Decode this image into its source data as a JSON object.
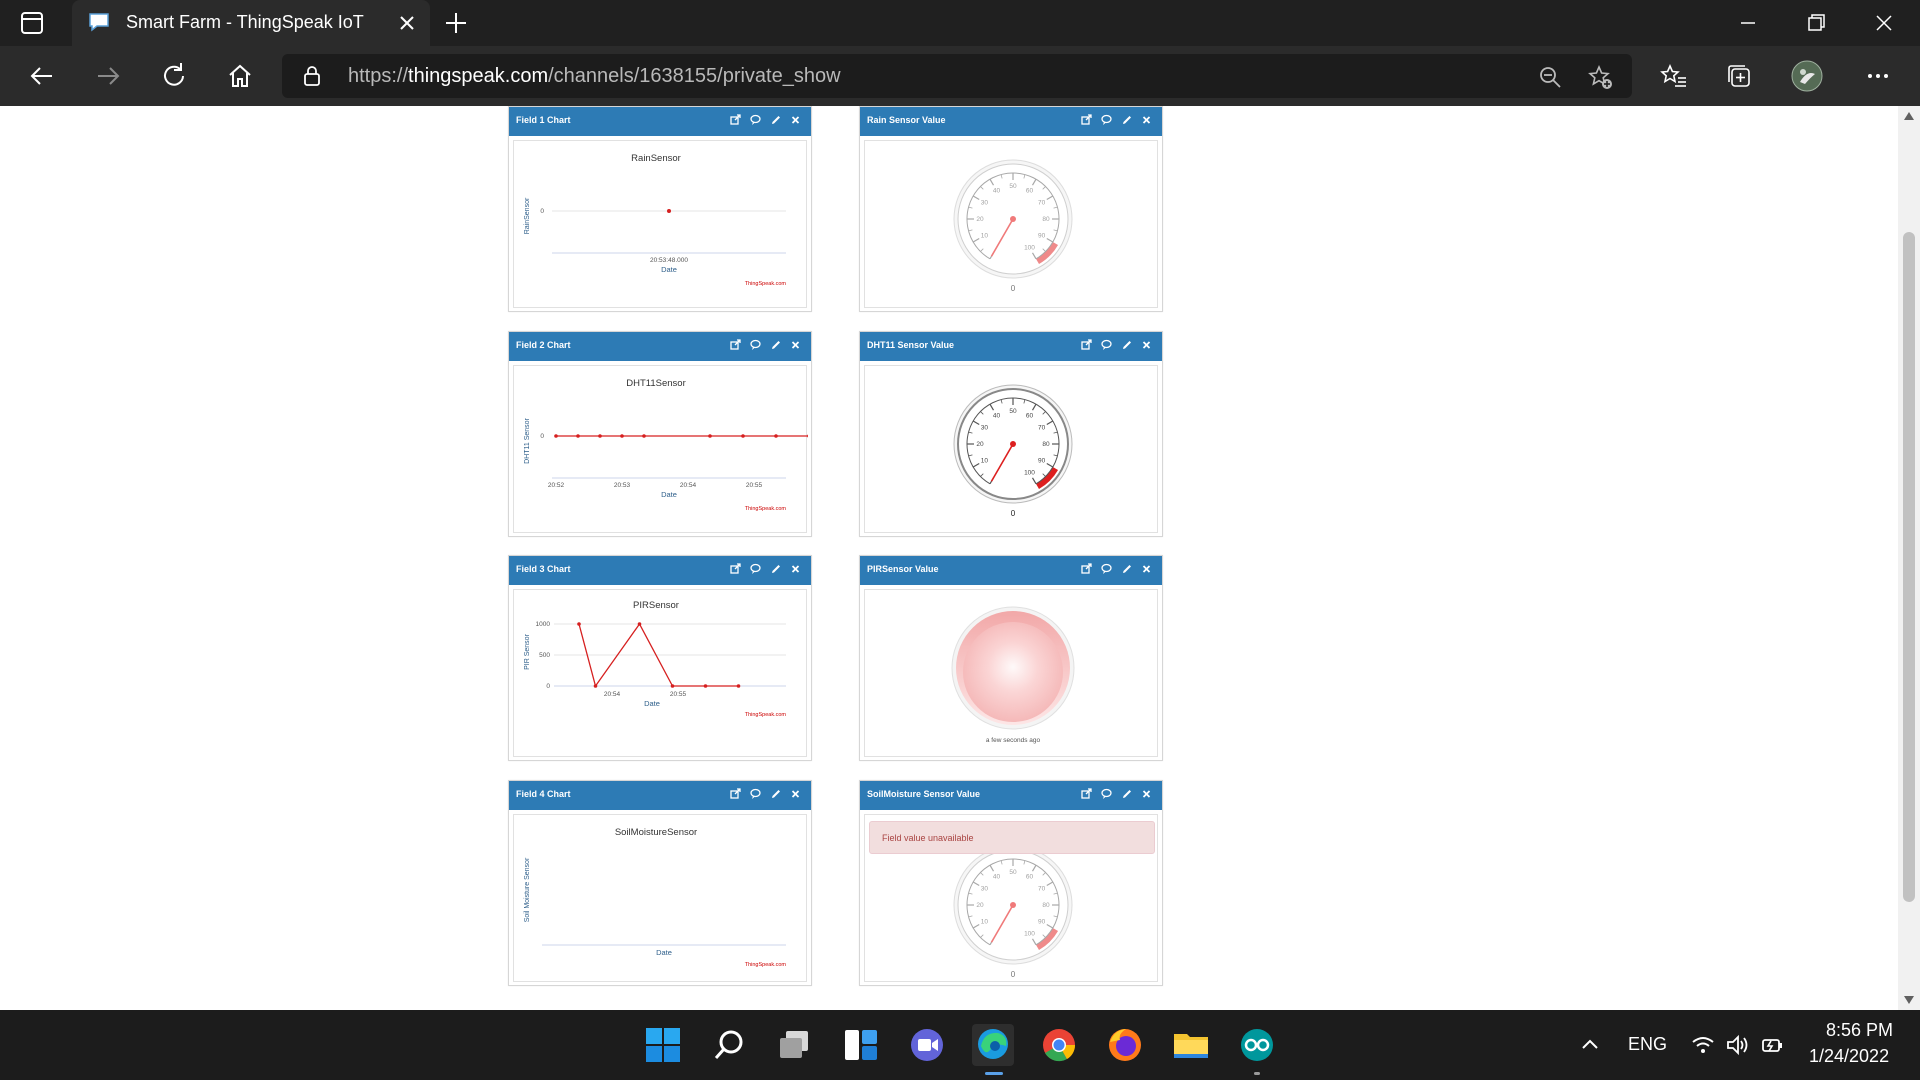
{
  "browser": {
    "tab_title": "Smart Farm - ThingSpeak IoT",
    "url_scheme": "https://",
    "url_host": "thingspeak.com",
    "url_path": "/channels/1638155/private_show"
  },
  "colors": {
    "header_blue": "#2d7bb5",
    "series_red": "#d62020",
    "chrome_dark": "#202020"
  },
  "cards": {
    "field1": {
      "title": "Field 1 Chart",
      "chart_title": "RainSensor",
      "ylabel": "RainSensor",
      "xlabel": "Date",
      "credit": "ThingSpeak.com",
      "ytick": "0",
      "xtick": "20:53:48.000"
    },
    "rain_gauge": {
      "title": "Rain Sensor Value",
      "value": "0"
    },
    "field2": {
      "title": "Field 2 Chart",
      "chart_title": "DHT11Sensor",
      "ylabel": "DHT11 Sensor",
      "xlabel": "Date",
      "credit": "ThingSpeak.com",
      "ytick": "0",
      "xticks": [
        "20:52",
        "20:53",
        "20:54",
        "20:55"
      ]
    },
    "dht_gauge": {
      "title": "DHT11 Sensor Value",
      "value": "0"
    },
    "field3": {
      "title": "Field 3 Chart",
      "chart_title": "PIRSensor",
      "ylabel": "PIR Sensor",
      "xlabel": "Date",
      "credit": "ThingSpeak.com",
      "yticks": [
        "1000",
        "500",
        "0"
      ],
      "xticks": [
        "20:54",
        "20:55"
      ]
    },
    "pir_lamp": {
      "title": "PIRSensor Value",
      "caption": "a few seconds ago"
    },
    "field4": {
      "title": "Field 4 Chart",
      "chart_title": "SoilMoistureSensor",
      "ylabel": "Soil Moisture Sensor",
      "xlabel": "Date",
      "credit": "ThingSpeak.com"
    },
    "soil_gauge": {
      "title": "SoilMoisture Sensor Value",
      "alert": "Field value unavailable",
      "value": "0"
    }
  },
  "gauge_scale": [
    "10",
    "20",
    "30",
    "40",
    "50",
    "60",
    "70",
    "80",
    "90",
    "100"
  ],
  "chart_data": [
    {
      "type": "line",
      "title": "RainSensor",
      "xlabel": "Date",
      "ylabel": "RainSensor",
      "x": [
        "20:53:48.000"
      ],
      "values": [
        0
      ]
    },
    {
      "type": "line",
      "title": "DHT11Sensor",
      "xlabel": "Date",
      "ylabel": "DHT11 Sensor",
      "x": [
        "20:52:00",
        "20:52:20",
        "20:52:40",
        "20:53:00",
        "20:53:20",
        "20:54:20",
        "20:54:50",
        "20:55:20",
        "20:55:50"
      ],
      "values": [
        0,
        0,
        0,
        0,
        0,
        0,
        0,
        0,
        0
      ]
    },
    {
      "type": "line",
      "title": "PIRSensor",
      "xlabel": "Date",
      "ylabel": "PIR Sensor",
      "ylim": [
        0,
        1000
      ],
      "x": [
        "20:53:30",
        "20:53:45",
        "20:54:25",
        "20:54:55",
        "20:55:25",
        "20:55:55"
      ],
      "values": [
        1000,
        0,
        1000,
        0,
        0,
        0
      ]
    },
    {
      "type": "line",
      "title": "SoilMoistureSensor",
      "xlabel": "Date",
      "ylabel": "Soil Moisture Sensor",
      "values": []
    }
  ],
  "taskbar": {
    "lang": "ENG",
    "time": "8:56 PM",
    "date": "1/24/2022"
  }
}
